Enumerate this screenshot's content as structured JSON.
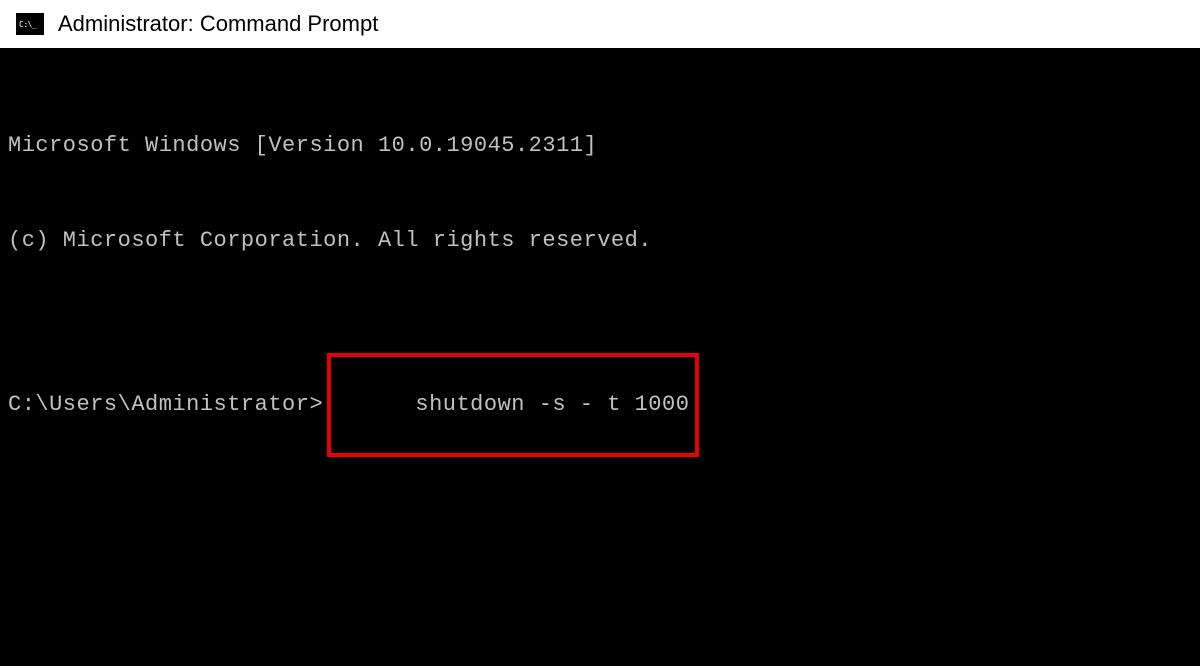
{
  "window": {
    "title": "Administrator: Command Prompt"
  },
  "terminal": {
    "line1": "Microsoft Windows [Version 10.0.19045.2311]",
    "line2": "(c) Microsoft Corporation. All rights reserved.",
    "prompt": "C:\\Users\\Administrator>",
    "command": "shutdown -s - t 1000"
  }
}
